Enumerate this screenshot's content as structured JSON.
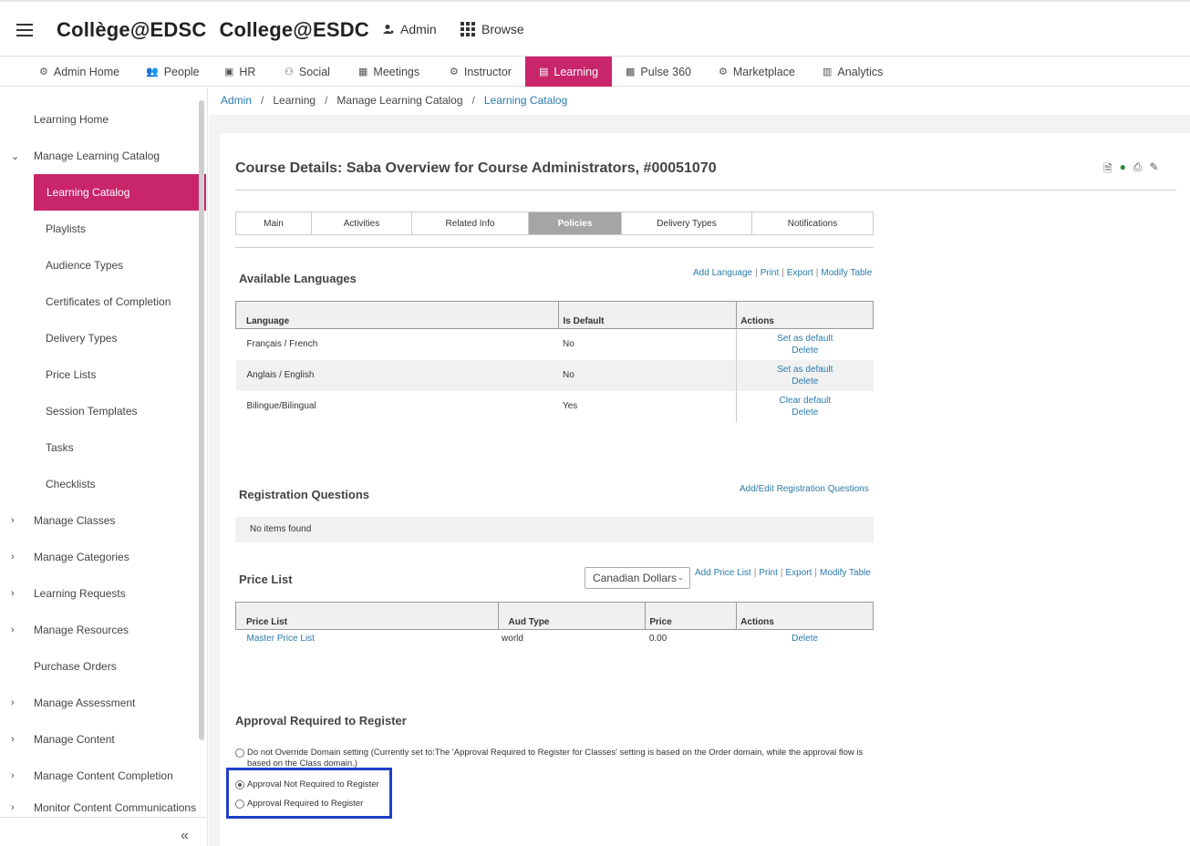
{
  "header": {
    "brand_fr": "Collège@EDSC",
    "brand_en": "College@ESDC",
    "admin_label": "Admin",
    "browse_label": "Browse"
  },
  "nav": {
    "items": [
      {
        "label": "Admin Home",
        "icon": "admin-home-icon"
      },
      {
        "label": "People",
        "icon": "people-icon"
      },
      {
        "label": "HR",
        "icon": "hr-icon"
      },
      {
        "label": "Social",
        "icon": "social-icon"
      },
      {
        "label": "Meetings",
        "icon": "meetings-icon"
      },
      {
        "label": "Instructor",
        "icon": "instructor-icon"
      },
      {
        "label": "Learning",
        "icon": "learning-icon",
        "active": true
      },
      {
        "label": "Pulse 360",
        "icon": "pulse-icon"
      },
      {
        "label": "Marketplace",
        "icon": "marketplace-icon"
      },
      {
        "label": "Analytics",
        "icon": "analytics-icon"
      }
    ],
    "active_color": "#c8256b"
  },
  "sidebar": {
    "items": [
      {
        "label": "Learning Home"
      },
      {
        "label": "Manage Learning Catalog",
        "expanded": true
      },
      {
        "label": "Learning Catalog",
        "active": true
      },
      {
        "label": "Playlists"
      },
      {
        "label": "Audience Types"
      },
      {
        "label": "Certificates of Completion"
      },
      {
        "label": "Delivery Types"
      },
      {
        "label": "Price Lists"
      },
      {
        "label": "Session Templates"
      },
      {
        "label": "Tasks"
      },
      {
        "label": "Checklists"
      },
      {
        "label": "Manage Classes",
        "collapsed": true
      },
      {
        "label": "Manage Categories",
        "collapsed": true
      },
      {
        "label": "Learning Requests",
        "collapsed": true
      },
      {
        "label": "Manage Resources",
        "collapsed": true
      },
      {
        "label": "Purchase Orders"
      },
      {
        "label": "Manage Assessment",
        "collapsed": true
      },
      {
        "label": "Manage Content",
        "collapsed": true
      },
      {
        "label": "Manage Content Completion",
        "collapsed": true
      },
      {
        "label": "Monitor Content Communications",
        "collapsed": true
      }
    ],
    "collapse_glyph": "«"
  },
  "breadcrumb": {
    "admin": "Admin",
    "learning": "Learning",
    "manage": "Manage Learning Catalog",
    "catalog": "Learning Catalog",
    "sep": "/"
  },
  "course": {
    "title": "Course Details: Saba Overview for Course Administrators, #00051070",
    "icons": [
      "document-icon",
      "globe-icon",
      "print-icon",
      "edit-icon"
    ]
  },
  "tabs": [
    {
      "label": "Main"
    },
    {
      "label": "Activities"
    },
    {
      "label": "Related Info"
    },
    {
      "label": "Policies",
      "active": true
    },
    {
      "label": "Delivery Types"
    },
    {
      "label": "Notifications"
    }
  ],
  "languages": {
    "title": "Available Languages",
    "links": [
      "Add Language",
      "Print",
      "Export",
      "Modify Table"
    ],
    "columns": [
      "Language",
      "Is Default",
      "Actions"
    ],
    "rows": [
      {
        "language": "Français / French",
        "is_default": "No",
        "action1": "Set as default",
        "action2": "Delete"
      },
      {
        "language": "Anglais / English",
        "is_default": "No",
        "action1": "Set as default",
        "action2": "Delete"
      },
      {
        "language": "Bilingue/Bilingual",
        "is_default": "Yes",
        "action1": "Clear default",
        "action2": "Delete"
      }
    ]
  },
  "registration": {
    "title": "Registration Questions",
    "link": "Add/Edit Registration Questions",
    "empty": "No items found"
  },
  "price_list": {
    "title": "Price List",
    "currency": "Canadian Dollars",
    "links": [
      "Add Price List",
      "Print",
      "Export",
      "Modify Table"
    ],
    "columns": [
      "Price List",
      "Aud Type",
      "Price",
      "Actions"
    ],
    "rows": [
      {
        "name": "Master Price List",
        "aud_type": "world",
        "price": "0.00",
        "action": "Delete"
      }
    ]
  },
  "approval": {
    "title": "Approval Required to Register",
    "options": [
      {
        "label": "Do not Override Domain setting (Currently set to:The 'Approval Required to Register for Classes' setting is based on the Order domain, while the approval flow is based on the Class domain.)",
        "selected": false
      },
      {
        "label": "Approval Not Required to Register",
        "selected": true
      },
      {
        "label": "Approval Required to Register",
        "selected": false
      }
    ],
    "highlight_color": "#1e40c6"
  }
}
